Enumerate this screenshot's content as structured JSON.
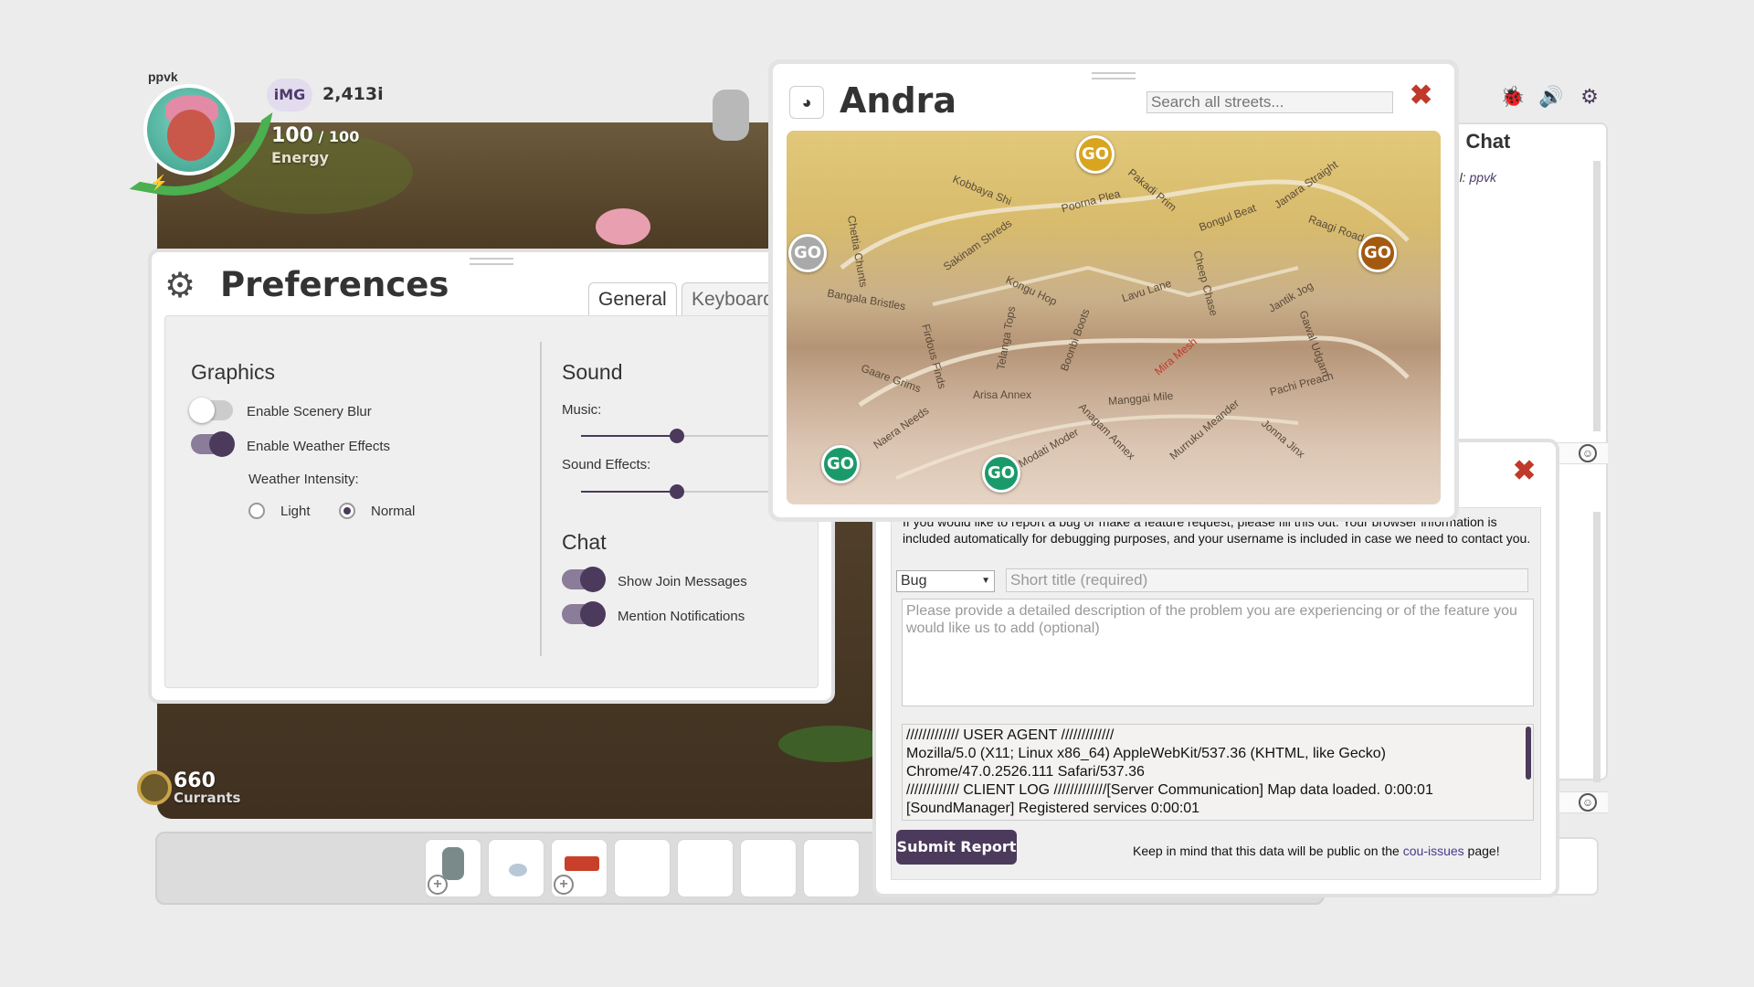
{
  "hud": {
    "username": "ppvk",
    "img_badge": "iMG",
    "img_value": "2,413i",
    "energy_current": "100",
    "energy_sep": " / ",
    "energy_max": "100",
    "energy_label": "Energy",
    "currants_value": "660",
    "currants_label": "Currants"
  },
  "top_icons": [
    "bug-icon",
    "speaker-icon",
    "gear-icon"
  ],
  "global_chat": {
    "title": "al Chat",
    "channel_prefix": "nel: ",
    "channel_user": "ppvk"
  },
  "preferences": {
    "title": "Preferences",
    "tabs": [
      "General",
      "Keyboard"
    ],
    "graphics": {
      "heading": "Graphics",
      "scenery_blur": {
        "label": "Enable Scenery Blur",
        "on": false
      },
      "weather_effects": {
        "label": "Enable Weather Effects",
        "on": true
      },
      "weather_intensity_label": "Weather Intensity:",
      "intensity_options": [
        "Light",
        "Normal"
      ],
      "intensity_selected": "Normal"
    },
    "sound": {
      "heading": "Sound",
      "music_label": "Music:",
      "music_level": 0.5,
      "sfx_label": "Sound Effects:",
      "sfx_level": 0.5
    },
    "chat": {
      "heading": "Chat",
      "join_messages": {
        "label": "Show Join Messages",
        "on": true
      },
      "mention_notifications": {
        "label": "Mention Notifications",
        "on": true
      }
    }
  },
  "map": {
    "title": "Andra",
    "search_placeholder": "Search all streets...",
    "go_label": "GO",
    "streets": [
      "Kobbaya Shi",
      "Poorna Plea",
      "Pakadi Prim",
      "Bongul Beat",
      "Janara Straight",
      "Raagi Road",
      "Chettia Chunts",
      "Sakinam Shreds",
      "Kongu Hop",
      "Lavu Lane",
      "Cheep Chase",
      "Jantik Jog",
      "Bangala Bristles",
      "Telanga Tops",
      "Firdous Finds",
      "Boonbi Boots",
      "Mira Mesh",
      "Gawal Udgam",
      "Gaare Grims",
      "Arisa Annex",
      "Manggai Mile",
      "Pachi Preach",
      "Naera Needs",
      "Anagam Annex",
      "Murruku Meander",
      "Modati Moder",
      "Jonna Jinx"
    ],
    "highlighted_street": "Mira Mesh"
  },
  "bug_report": {
    "intro": "If you would like to report a bug or make a feature request, please fill this out. Your browser information is included automatically for debugging purposes, and your username is included in case we need to contact you.",
    "type_selected": "Bug",
    "title_placeholder": "Short title (required)",
    "description_placeholder": "Please provide a detailed description of the problem you are experiencing or of the feature you would like us to add (optional)",
    "log_lines": [
      "///////////// USER AGENT /////////////",
      "Mozilla/5.0 (X11; Linux x86_64) AppleWebKit/537.36 (KHTML, like Gecko)",
      "Chrome/47.0.2526.111 Safari/537.36",
      "///////////// CLIENT LOG /////////////[Server Communication] Map data loaded. 0:00:01",
      "[SoundManager] Registered services 0:00:01"
    ],
    "submit_label": "Submit Report",
    "note_prefix": "Keep in mind that this data will be public on the ",
    "note_link": "cou-issues",
    "note_suffix": " page!"
  },
  "colors": {
    "accent": "#4b3a5b",
    "close_red": "#c0392b",
    "go_gold": "#d9a420",
    "go_green": "#1a9a6a",
    "go_grey": "#a9a9a9",
    "go_brown": "#a35a10"
  }
}
